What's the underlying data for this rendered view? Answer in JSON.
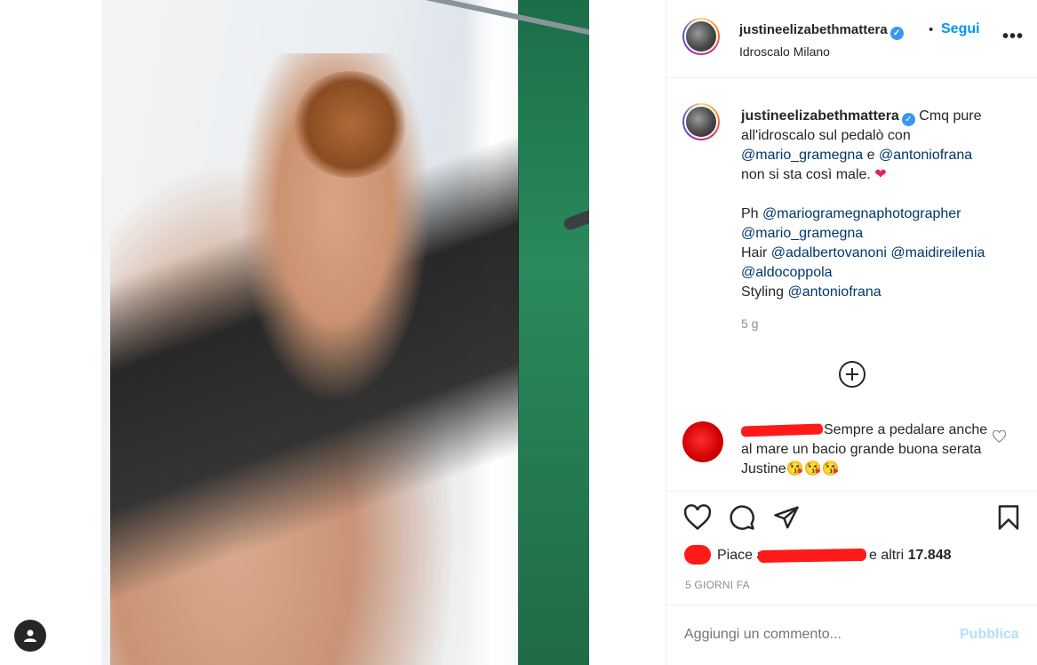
{
  "post": {
    "username": "justineelizabethmattera",
    "follow_label": "Segui",
    "separator": "•",
    "location": "Idroscalo Milano",
    "more_label": "•••"
  },
  "caption": {
    "username": "justineelizabethmattera",
    "line1": "Cmq pure",
    "line2": "all'idroscalo sul pedalò con",
    "mention_mario": "@mario_gramegna",
    "and_text": " e ",
    "mention_antonio": "@antoniofrana",
    "line4": "non si sta così male.",
    "heart": "❤",
    "ph_prefix": "Ph ",
    "mention_photographer": "@mariogramegnaphotographer",
    "mention_mario2": "@mario_gramegna",
    "hair_prefix": "Hair ",
    "mention_adalberto": "@adalbertovanoni",
    "mention_maidire": "@maidireilenia",
    "mention_aldo": "@aldocoppola",
    "styling_prefix": "Styling ",
    "mention_antonio2": "@antoniofrana",
    "time": "5 g",
    "load_more_icon": "plus-circle-icon"
  },
  "comment": {
    "text": "Sempre a pedalare anche al mare un bacio grande buona serata Justine😘😘😘",
    "like_icon": "heart-outline-icon"
  },
  "likes": {
    "prefix": "Piace a",
    "suffix": "e altri",
    "count": "17.848"
  },
  "date_label": "5 GIORNI FA",
  "add_comment": {
    "placeholder": "Aggiungi un commento...",
    "publish_label": "Pubblica"
  },
  "colors": {
    "accent": "#0095f6",
    "verified": "#3897f0",
    "publish_disabled": "#b2dffc",
    "muted": "#8e8e8e",
    "mention": "#00376b"
  }
}
